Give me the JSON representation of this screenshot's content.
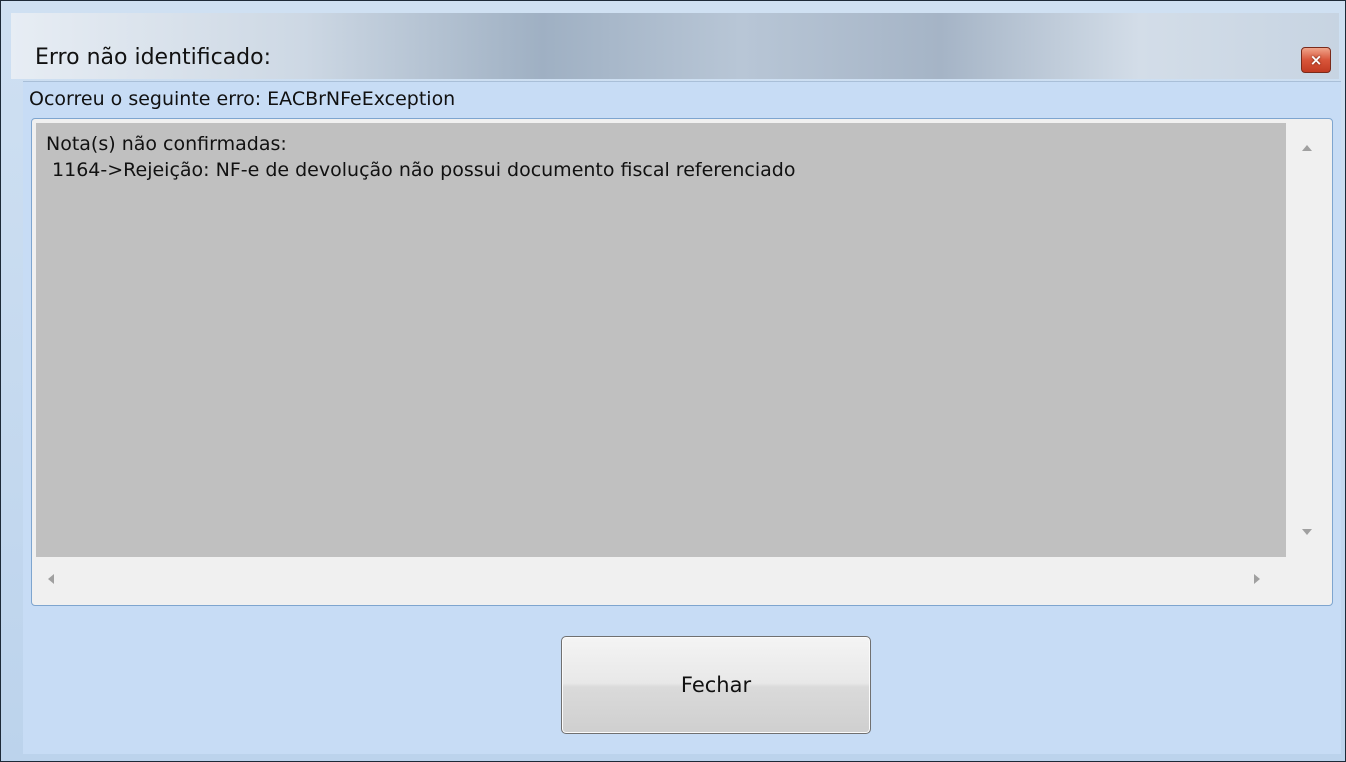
{
  "window": {
    "title": "Erro não identificado:",
    "close_symbol": "×"
  },
  "header": {
    "message": "Ocorreu o seguinte erro: EACBrNFeException"
  },
  "memo": {
    "lines": [
      "Nota(s) não confirmadas:",
      " 1164->Rejeição: NF-e de devolução não possui documento fiscal referenciado"
    ]
  },
  "buttons": {
    "close_label": "Fechar"
  },
  "icons": {
    "close": "close-icon",
    "scroll_up": "scroll-up-arrow-icon",
    "scroll_down": "scroll-down-arrow-icon",
    "scroll_left": "scroll-left-arrow-icon",
    "scroll_right": "scroll-right-arrow-icon"
  },
  "colors": {
    "client_background": "#c7dcf5",
    "memo_background": "#c0c0c0",
    "close_button": "#d8553a"
  }
}
